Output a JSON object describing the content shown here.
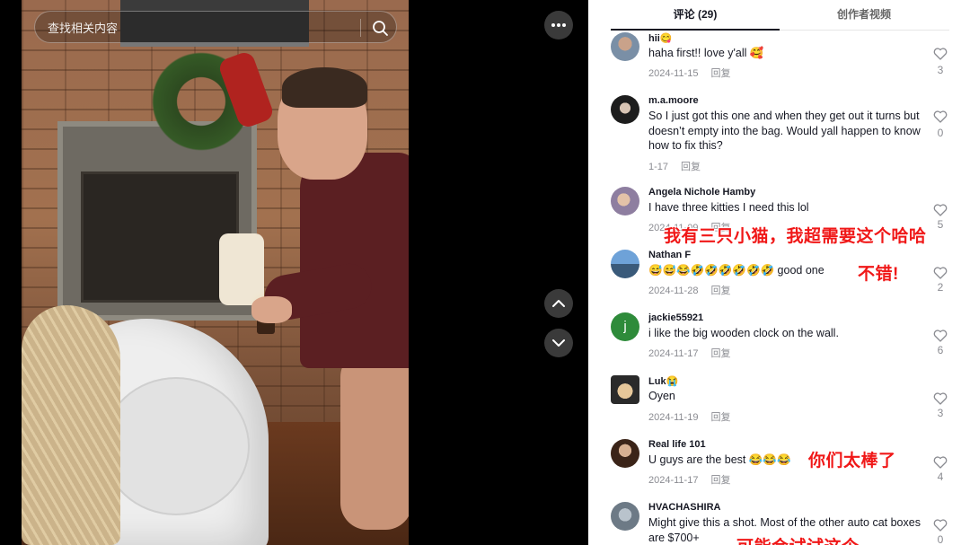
{
  "search": {
    "placeholder": "查找相关内容"
  },
  "tabs": {
    "comments": "评论 (29)",
    "creator_videos": "创作者视频"
  },
  "comments": [
    {
      "user": "hii😋",
      "text": "haha first!! love y'all 🥰",
      "date": "2024-11-15",
      "reply": "回复",
      "likes": "3"
    },
    {
      "user": "m.a.moore",
      "text": "So I just got this one and when they get out it turns but doesn’t empty into the bag. Would yall happen to know how to fix this?",
      "date": "1-17",
      "reply": "回复",
      "likes": "0"
    },
    {
      "user": "Angela Nichole Hamby",
      "text": "I have three kitties I need this lol",
      "date": "2024-11-09",
      "reply": "回复",
      "likes": "5"
    },
    {
      "user": "Nathan F",
      "text": "😅😅😂🤣🤣🤣🤣🤣🤣 good one",
      "date": "2024-11-28",
      "reply": "回复",
      "likes": "2"
    },
    {
      "user": "jackie55921",
      "text": "i like the big wooden clock on the wall.",
      "date": "2024-11-17",
      "reply": "回复",
      "likes": "6"
    },
    {
      "user": "Luk😭",
      "text": "Oyen",
      "date": "2024-11-19",
      "reply": "回复",
      "likes": "3"
    },
    {
      "user": "Real life 101",
      "text": "U guys are the best 😂😂😂",
      "date": "2024-11-17",
      "reply": "回复",
      "likes": "4"
    },
    {
      "user": "HVACHASHIRA",
      "text": "Might give this a shot. Most of the other auto cat boxes are $700+",
      "date": "",
      "reply": "",
      "likes": "0"
    }
  ],
  "overlays": {
    "translation_1": "我有三只小猫，我超需要这个哈哈",
    "translation_2": "不错!",
    "translation_3": "你们太棒了",
    "translation_4": "可能会试试这个"
  },
  "avatar_initial_jackie": "j",
  "colors": {
    "accent_text": "#161823",
    "muted": "#8a8b91",
    "overlay_red": "#f01818",
    "avatar_jackie": "#2e8b3a"
  },
  "icons": [
    "search-icon",
    "more-icon",
    "chevron-up-icon",
    "chevron-down-icon",
    "heart-icon"
  ]
}
